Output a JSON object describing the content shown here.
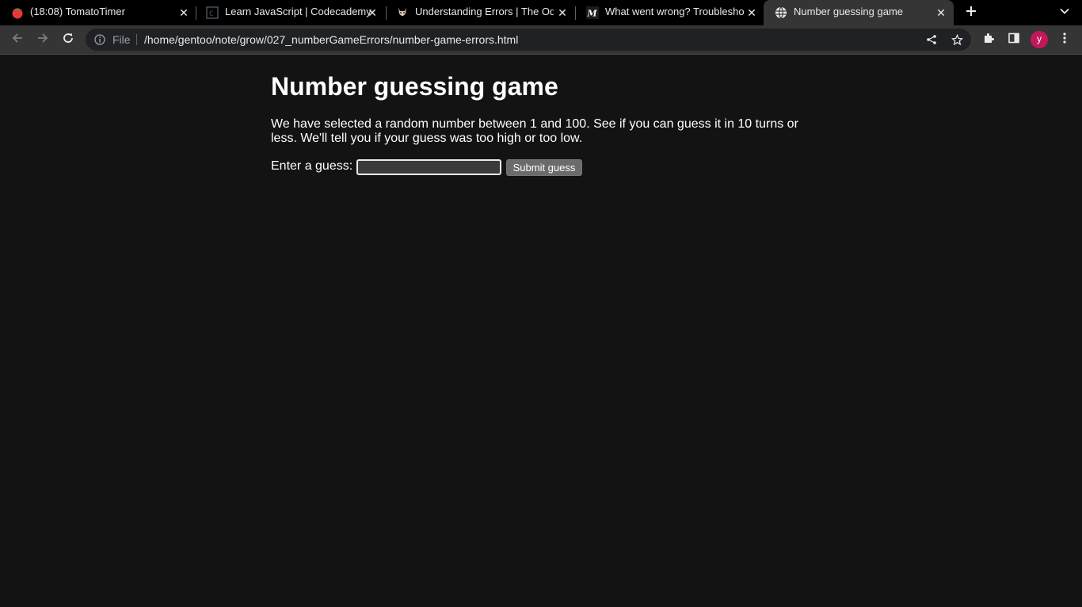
{
  "tabs": [
    {
      "title": "(18:08) TomatoTimer",
      "icon": "tomato-icon",
      "active": false
    },
    {
      "title": "Learn JavaScript | Codecademy",
      "icon": "codecademy-icon",
      "active": false
    },
    {
      "title": "Understanding Errors | The Odin Project",
      "icon": "odin-project-icon",
      "active": false
    },
    {
      "title": "What went wrong? Troubleshooting JavaScript",
      "icon": "mdn-icon",
      "active": false
    },
    {
      "title": "Number guessing game",
      "icon": "globe-icon",
      "active": true
    }
  ],
  "omnibox": {
    "scheme_label": "File",
    "url": "/home/gentoo/note/grow/027_numberGameErrors/number-game-errors.html"
  },
  "profile": {
    "initial": "y",
    "color": "#c2185b"
  },
  "page": {
    "heading": "Number guessing game",
    "intro": "We have selected a random number between 1 and 100. See if you can guess it in 10 turns or less. We'll tell you if your guess was too high or too low.",
    "guess_label": "Enter a guess:",
    "guess_value": "",
    "submit_label": "Submit guess"
  },
  "colors": {
    "page_background": "#131313",
    "tab_strip": "#000000",
    "toolbar": "#353535",
    "avatar": "#c2185b"
  }
}
